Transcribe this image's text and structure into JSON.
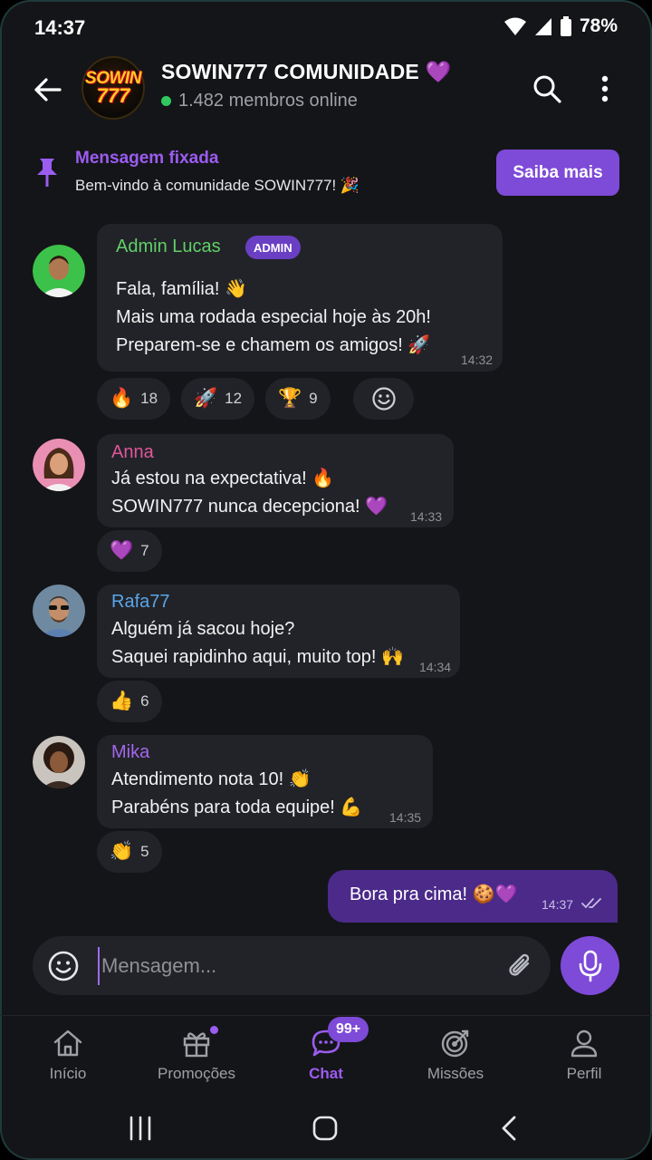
{
  "status_bar": {
    "time": "14:37",
    "battery": "78%"
  },
  "header": {
    "avatar_text_line1": "SOWIN",
    "avatar_text_line2": "777",
    "title": "SOWIN777 COMUNIDADE 💜",
    "subtitle": "1.482 membros online"
  },
  "pinned": {
    "title": "Mensagem fixada",
    "text": "Bem-vindo à comunidade SOWIN777! 🎉",
    "button": "Saiba mais"
  },
  "messages": [
    {
      "sender": "Admin Lucas",
      "badge": "ADMIN",
      "lines": "Fala, família! 👋\nMais uma rodada especial hoje às 20h!\nPreparem-se e chamem os amigos! 🚀",
      "time": "14:32",
      "name_color": "#5fd068",
      "reactions": [
        {
          "emoji": "🔥",
          "count": "18"
        },
        {
          "emoji": "🚀",
          "count": "12"
        },
        {
          "emoji": "🏆",
          "count": "9"
        }
      ]
    },
    {
      "sender": "Anna",
      "lines": "Já estou na expectativa! 🔥\nSOWIN777 nunca decepciona! 💜",
      "time": "14:33",
      "name_color": "#e0569a",
      "reactions": [
        {
          "emoji": "💜",
          "count": "7"
        }
      ]
    },
    {
      "sender": "Rafa77",
      "lines": "Alguém já sacou hoje?\nSaquei rapidinho aqui, muito top! 🙌",
      "time": "14:34",
      "name_color": "#5aa6e8",
      "reactions": [
        {
          "emoji": "👍",
          "count": "6"
        }
      ]
    },
    {
      "sender": "Mika",
      "lines": "Atendimento nota 10! 👏\nParabéns para toda equipe! 💪",
      "time": "14:35",
      "name_color": "#a466ee",
      "reactions": [
        {
          "emoji": "👏",
          "count": "5"
        }
      ]
    }
  ],
  "own_message": {
    "text": "Bora pra cima! 🍪💜",
    "time": "14:37"
  },
  "composer": {
    "placeholder": "Mensagem..."
  },
  "bottom_nav": {
    "items": [
      {
        "label": "Início"
      },
      {
        "label": "Promoções"
      },
      {
        "label": "Chat",
        "badge": "99+"
      },
      {
        "label": "Missões"
      },
      {
        "label": "Perfil"
      }
    ]
  },
  "colors": {
    "accent": "#7e4ad8",
    "accent_text": "#9b5cf0",
    "background": "#141518",
    "bubble": "#222328",
    "own_bubble": "#4b2a8a"
  }
}
